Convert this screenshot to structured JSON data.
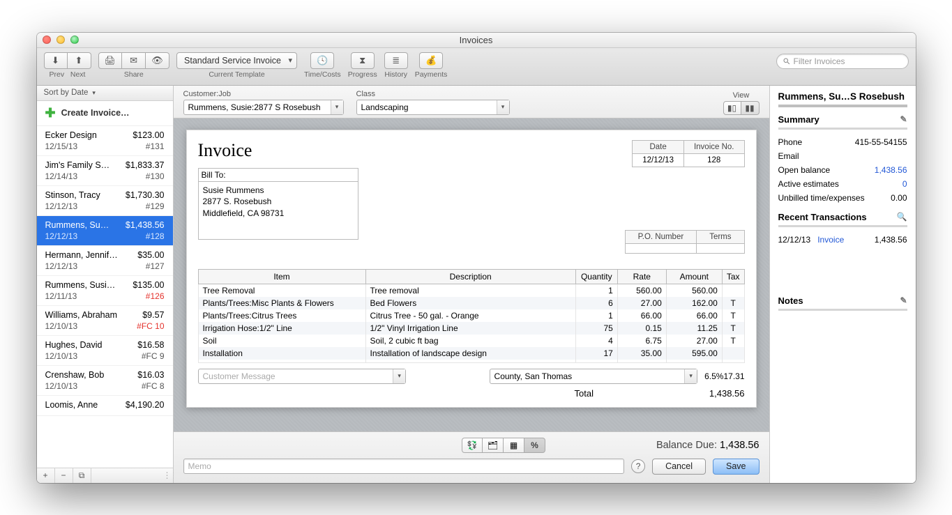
{
  "window": {
    "title": "Invoices"
  },
  "toolbar": {
    "prev": "Prev",
    "next": "Next",
    "share": "Share",
    "template": "Current Template",
    "template_value": "Standard Service Invoice",
    "timecosts": "Time/Costs",
    "progress": "Progress",
    "history": "History",
    "payments": "Payments",
    "search_placeholder": "Filter Invoices"
  },
  "left": {
    "sort_label": "Sort by Date",
    "create": "Create Invoice…",
    "items": [
      {
        "name": "Ecker Design",
        "amount": "$123.00",
        "date": "12/15/13",
        "num": "#131"
      },
      {
        "name": "Jim's Family S…",
        "amount": "$1,833.37",
        "date": "12/14/13",
        "num": "#130"
      },
      {
        "name": "Stinson, Tracy",
        "amount": "$1,730.30",
        "date": "12/12/13",
        "num": "#129"
      },
      {
        "name": "Rummens, Su…",
        "amount": "$1,438.56",
        "date": "12/12/13",
        "num": "#128",
        "selected": true
      },
      {
        "name": "Hermann, Jennif…",
        "amount": "$35.00",
        "date": "12/12/13",
        "num": "#127"
      },
      {
        "name": "Rummens, Susi…",
        "amount": "$135.00",
        "date": "12/11/13",
        "num": "#126",
        "red": true
      },
      {
        "name": "Williams, Abraham",
        "amount": "$9.57",
        "date": "12/10/13",
        "num": "#FC 10",
        "red": true
      },
      {
        "name": "Hughes, David",
        "amount": "$16.58",
        "date": "12/10/13",
        "num": "#FC 9"
      },
      {
        "name": "Crenshaw, Bob",
        "amount": "$16.03",
        "date": "12/10/13",
        "num": "#FC 8"
      },
      {
        "name": "Loomis, Anne",
        "amount": "$4,190.20",
        "date": "",
        "num": ""
      }
    ]
  },
  "center_head": {
    "customer_label": "Customer:Job",
    "customer_value": "Rummens, Susie:2877 S Rosebush",
    "class_label": "Class",
    "class_value": "Landscaping",
    "view_label": "View"
  },
  "invoice": {
    "title": "Invoice",
    "date_label": "Date",
    "date": "12/12/13",
    "no_label": "Invoice No.",
    "no": "128",
    "billto_label": "Bill To:",
    "billto_line1": "Susie Rummens",
    "billto_line2": "2877 S. Rosebush",
    "billto_line3": "Middlefield, CA  98731",
    "po_label": "P.O. Number",
    "terms_label": "Terms",
    "cols": {
      "item": "Item",
      "desc": "Description",
      "qty": "Quantity",
      "rate": "Rate",
      "amount": "Amount",
      "tax": "Tax"
    },
    "lines": [
      {
        "item": "Tree Removal",
        "desc": "Tree removal",
        "qty": "1",
        "rate": "560.00",
        "amount": "560.00",
        "tax": ""
      },
      {
        "item": "Plants/Trees:Misc Plants & Flowers",
        "desc": "Bed Flowers",
        "qty": "6",
        "rate": "27.00",
        "amount": "162.00",
        "tax": "T"
      },
      {
        "item": "Plants/Trees:Citrus Trees",
        "desc": "Citrus Tree - 50 gal. - Orange",
        "qty": "1",
        "rate": "66.00",
        "amount": "66.00",
        "tax": "T"
      },
      {
        "item": "Irrigation Hose:1/2\" Line",
        "desc": "1/2\"  Vinyl Irrigation Line",
        "qty": "75",
        "rate": "0.15",
        "amount": "11.25",
        "tax": "T"
      },
      {
        "item": "Soil",
        "desc": "Soil, 2 cubic ft bag",
        "qty": "4",
        "rate": "6.75",
        "amount": "27.00",
        "tax": "T"
      },
      {
        "item": "Installation",
        "desc": "Installation of landscape design",
        "qty": "17",
        "rate": "35.00",
        "amount": "595.00",
        "tax": ""
      },
      {
        "item": "",
        "desc": "",
        "qty": "",
        "rate": "",
        "amount": "",
        "tax": ""
      }
    ],
    "cust_msg_placeholder": "Customer Message",
    "tax_code": "County, San Thomas",
    "tax_rate": "6.5%",
    "tax_amount": "17.31",
    "total_label": "Total",
    "total": "1,438.56"
  },
  "footer": {
    "balance_label": "Balance Due:",
    "balance": "1,438.56",
    "memo_placeholder": "Memo",
    "cancel": "Cancel",
    "save": "Save"
  },
  "right": {
    "title": "Rummens, Su…S Rosebush",
    "summary": "Summary",
    "phone_l": "Phone",
    "phone_v": "415-55-54155",
    "email_l": "Email",
    "email_v": "",
    "open_l": "Open balance",
    "open_v": "1,438.56",
    "active_l": "Active estimates",
    "active_v": "0",
    "unbill_l": "Unbilled time/expenses",
    "unbill_v": "0.00",
    "recent": "Recent Transactions",
    "tx_date": "12/12/13",
    "tx_type": "Invoice",
    "tx_amt": "1,438.56",
    "notes": "Notes"
  }
}
